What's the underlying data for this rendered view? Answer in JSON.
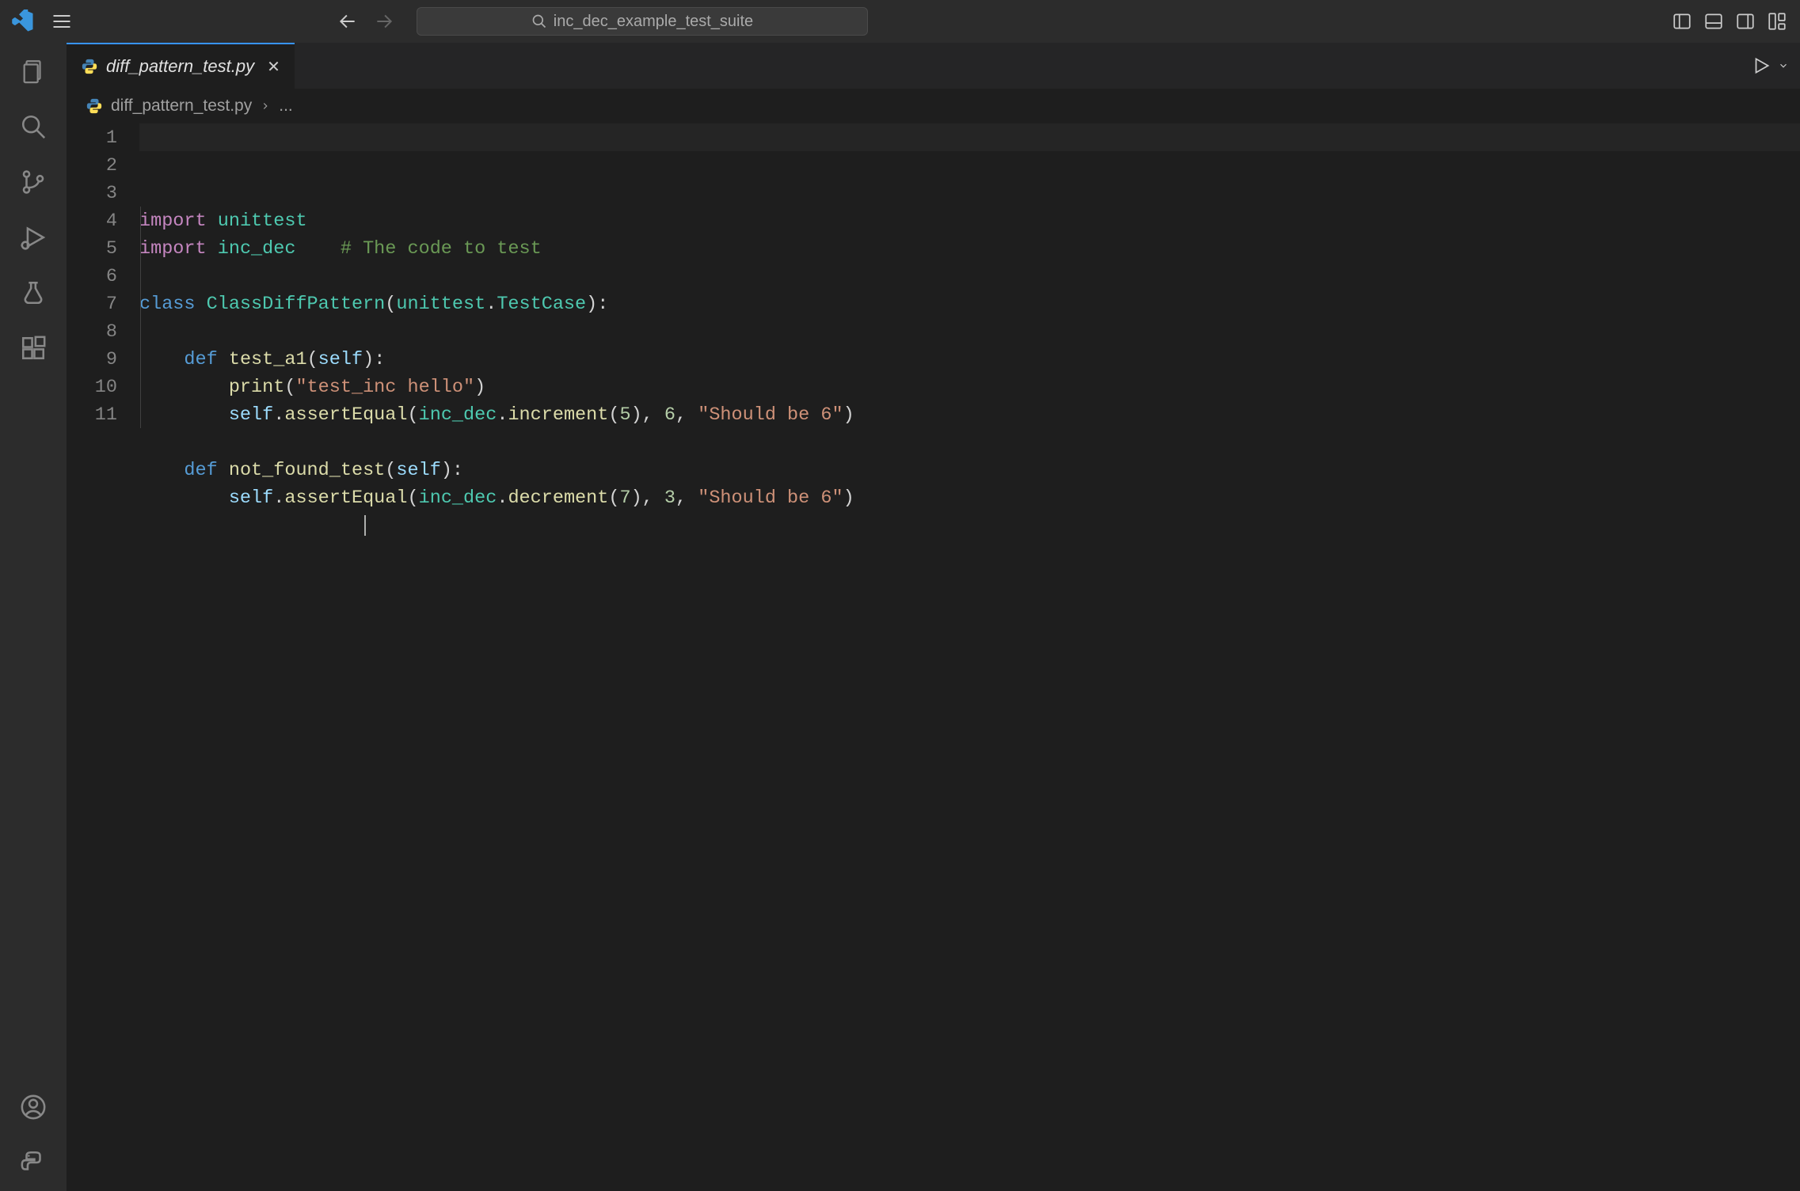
{
  "titlebar": {
    "search": "inc_dec_example_test_suite"
  },
  "tab": {
    "filename": "diff_pattern_test.py"
  },
  "breadcrumb": {
    "filename": "diff_pattern_test.py",
    "suffix": "..."
  },
  "code": {
    "lines": [
      {
        "n": 1,
        "tokens": [
          [
            "kw",
            "import"
          ],
          [
            "pn",
            " "
          ],
          [
            "mod",
            "unittest"
          ]
        ]
      },
      {
        "n": 2,
        "tokens": [
          [
            "kw",
            "import"
          ],
          [
            "pn",
            " "
          ],
          [
            "mod",
            "inc_dec"
          ],
          [
            "pn",
            "    "
          ],
          [
            "cm",
            "# The code to test"
          ]
        ]
      },
      {
        "n": 3,
        "tokens": []
      },
      {
        "n": 4,
        "tokens": [
          [
            "blue",
            "class"
          ],
          [
            "pn",
            " "
          ],
          [
            "cls",
            "ClassDiffPattern"
          ],
          [
            "pn",
            "("
          ],
          [
            "cls",
            "unittest"
          ],
          [
            "pn",
            "."
          ],
          [
            "cls",
            "TestCase"
          ],
          [
            "pn",
            "):"
          ]
        ]
      },
      {
        "n": 5,
        "tokens": []
      },
      {
        "n": 6,
        "tokens": [
          [
            "pn",
            "    "
          ],
          [
            "blue",
            "def"
          ],
          [
            "pn",
            " "
          ],
          [
            "fn",
            "test_a1"
          ],
          [
            "pn",
            "("
          ],
          [
            "var",
            "self"
          ],
          [
            "pn",
            "):"
          ]
        ]
      },
      {
        "n": 7,
        "tokens": [
          [
            "pn",
            "        "
          ],
          [
            "fn",
            "print"
          ],
          [
            "pn",
            "("
          ],
          [
            "str",
            "\"test_inc hello\""
          ],
          [
            "pn",
            ")"
          ]
        ]
      },
      {
        "n": 8,
        "tokens": [
          [
            "pn",
            "        "
          ],
          [
            "var",
            "self"
          ],
          [
            "pn",
            "."
          ],
          [
            "fn",
            "assertEqual"
          ],
          [
            "pn",
            "("
          ],
          [
            "mod",
            "inc_dec"
          ],
          [
            "pn",
            "."
          ],
          [
            "fn",
            "increment"
          ],
          [
            "pn",
            "("
          ],
          [
            "num",
            "5"
          ],
          [
            "pn",
            "), "
          ],
          [
            "num",
            "6"
          ],
          [
            "pn",
            ", "
          ],
          [
            "str",
            "\"Should be 6\""
          ],
          [
            "pn",
            ")"
          ]
        ]
      },
      {
        "n": 9,
        "tokens": []
      },
      {
        "n": 10,
        "tokens": [
          [
            "pn",
            "    "
          ],
          [
            "blue",
            "def"
          ],
          [
            "pn",
            " "
          ],
          [
            "fn",
            "not_found_test"
          ],
          [
            "pn",
            "("
          ],
          [
            "var",
            "self"
          ],
          [
            "pn",
            "):"
          ]
        ]
      },
      {
        "n": 11,
        "tokens": [
          [
            "pn",
            "        "
          ],
          [
            "var",
            "self"
          ],
          [
            "pn",
            "."
          ],
          [
            "fn",
            "assertEqual"
          ],
          [
            "pn",
            "("
          ],
          [
            "mod",
            "inc_dec"
          ],
          [
            "pn",
            "."
          ],
          [
            "fn",
            "decrement"
          ],
          [
            "pn",
            "("
          ],
          [
            "num",
            "7"
          ],
          [
            "pn",
            "), "
          ],
          [
            "num",
            "3"
          ],
          [
            "pn",
            ", "
          ],
          [
            "str",
            "\"Should be 6\""
          ],
          [
            "pn",
            ")"
          ]
        ]
      }
    ]
  }
}
